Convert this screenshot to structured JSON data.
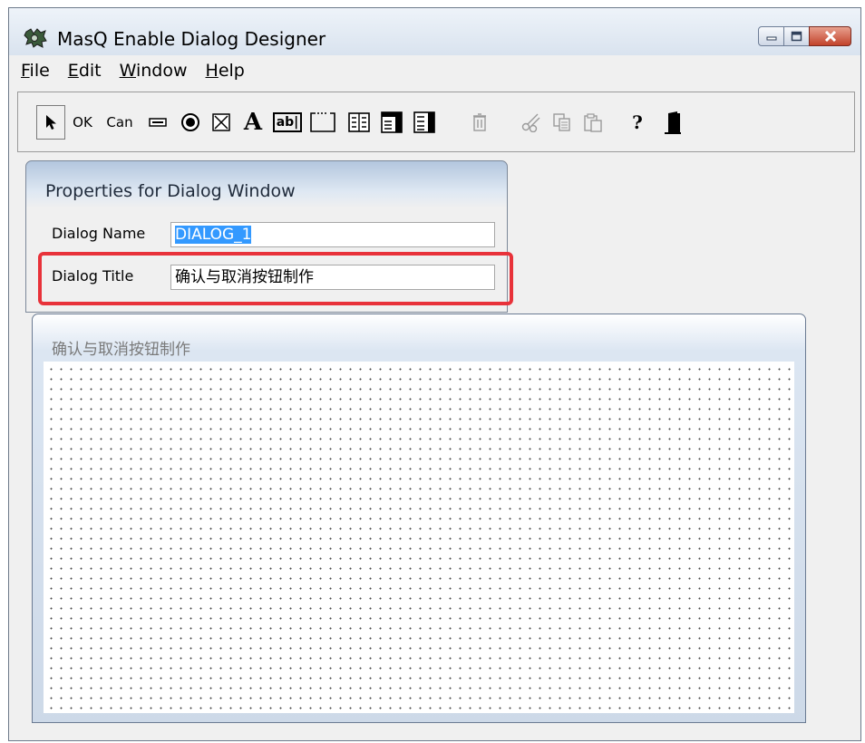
{
  "window": {
    "title": "MasQ Enable Dialog Designer",
    "buttons": {
      "minimize": "minimize",
      "maximize": "maximize",
      "close": "close"
    }
  },
  "menu": {
    "items": [
      {
        "mnemonic": "F",
        "rest": "ile"
      },
      {
        "mnemonic": "E",
        "rest": "dit"
      },
      {
        "mnemonic": "W",
        "rest": "indow"
      },
      {
        "mnemonic": "H",
        "rest": "elp"
      }
    ]
  },
  "toolbar": {
    "ok_label": "OK",
    "cancel_label": "Can",
    "text_label": "A",
    "edit_label": "ab|",
    "help_label": "?",
    "icons": [
      "pointer-icon",
      "ok-button-tool",
      "cancel-button-tool",
      "pushbutton-icon",
      "radio-icon",
      "checkbox-icon",
      "text-icon",
      "edit-field-icon",
      "groupbox-icon",
      "listbox-icon",
      "combobox-icon",
      "dropdown-list-icon",
      "trash-icon",
      "cut-icon",
      "copy-icon",
      "paste-icon",
      "help-icon",
      "exit-door-icon"
    ]
  },
  "properties": {
    "title": "Properties for Dialog Window",
    "dialog_name_label": "Dialog Name",
    "dialog_name_value": "DIALOG_1",
    "dialog_title_label": "Dialog Title",
    "dialog_title_value": "确认与取消按钮制作"
  },
  "dialog_preview": {
    "title": "确认与取消按钮制作"
  },
  "colors": {
    "selection": "#3399ff",
    "highlight_border": "#e8323a",
    "close_button": "#c2432b"
  }
}
